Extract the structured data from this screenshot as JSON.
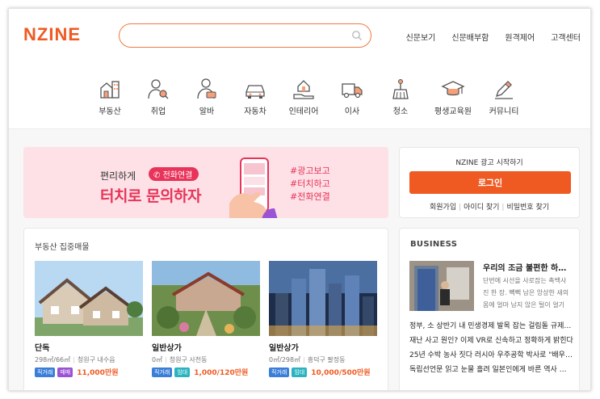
{
  "header": {
    "logo_text": "NZINE",
    "search_placeholder": "",
    "nav": [
      "신문보기",
      "신문배부함",
      "원격제어",
      "고객센터"
    ]
  },
  "categories": [
    {
      "label": "부동산",
      "icon": "building-icon"
    },
    {
      "label": "취업",
      "icon": "person-search-icon"
    },
    {
      "label": "알바",
      "icon": "person-laptop-icon"
    },
    {
      "label": "자동차",
      "icon": "car-icon"
    },
    {
      "label": "인테리어",
      "icon": "house-hand-icon"
    },
    {
      "label": "이사",
      "icon": "truck-icon"
    },
    {
      "label": "청소",
      "icon": "broom-icon"
    },
    {
      "label": "평생교육원",
      "icon": "graduation-cap-icon"
    },
    {
      "label": "커뮤니티",
      "icon": "pen-icon"
    }
  ],
  "banner": {
    "line1": "편리하게",
    "pill": "전화연결",
    "line2": "터치로 문의하자",
    "tags": [
      "#광고보고",
      "#터치하고",
      "#전화연결"
    ]
  },
  "login": {
    "title": "NZINE 광고 시작하기",
    "button": "로그인",
    "links": [
      "회원가입",
      "아이디 찾기",
      "비밀번호 찾기"
    ]
  },
  "realestate": {
    "title": "부동산 집중매물",
    "listings": [
      {
        "name": "단독",
        "size": "298㎡/66㎡",
        "location": "청원구 내수읍",
        "badges": [
          "직거래",
          "매매"
        ],
        "price": "11,000만원"
      },
      {
        "name": "일반상가",
        "size": "0㎡",
        "location": "청원구 사천동",
        "badges": [
          "직거래",
          "임대"
        ],
        "price": "1,000/120만원"
      },
      {
        "name": "일반상가",
        "size": "0㎡/298㎡",
        "location": "흥덕구 팔정동",
        "badges": [
          "직거래",
          "임대"
        ],
        "price": "10,000/500만원"
      }
    ]
  },
  "business": {
    "title": "BUSINESS",
    "headline": "우리의 조금 불편한 하루…",
    "summary": "단번에 시선을 사로잡는 촉백사 진 한 장. 빽빽 남은 앙상한 새의 몸에 얼마 남지 않은 털이 얼기",
    "items": [
      "정부, 소 상반기 내 민생경제 발목 잡는 걸림돌 규제…",
      "재난 사고 원인? 이제 VR로 신속하고 정확하게 밝힌다",
      "25년 수박 농사 짓다 러시아 우주공학 박사로 \"배우…",
      "독립선언문 읽고 눈물 흘려 일본인에게 바른 역사 …"
    ]
  },
  "colors": {
    "brand": "#ef5a23",
    "pink": "#e8335a",
    "blue": "#3b7ed8",
    "purple": "#9b53d6",
    "teal": "#2bb3c0"
  }
}
